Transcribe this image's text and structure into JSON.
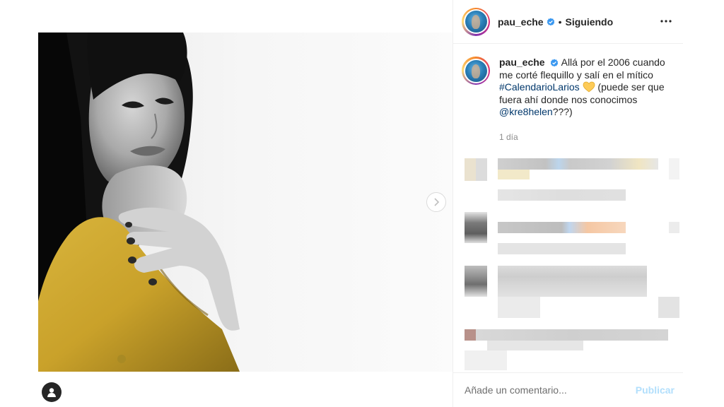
{
  "post": {
    "username": "pau_eche",
    "follow_state": "Siguiendo",
    "dot": "•"
  },
  "caption": {
    "username": "pau_eche",
    "text_1": "Allá por el 2006 cuando me corté flequillo y salí en el mítico",
    "hashtag": "#CalendarioLarios",
    "text_2": "(puede ser que fuera ahí donde nos conocimos",
    "mention": "@kre8helen",
    "text_3": "???)",
    "timestamp": "1 día"
  },
  "footer": {
    "placeholder": "Añade un comentario...",
    "publish_label": "Publicar"
  },
  "colors": {
    "verified": "#3897f0",
    "link": "#00376b",
    "publish_disabled": "#b2dffc",
    "heart": "#fdcb58"
  },
  "icons": {
    "verified": "verified-badge-icon",
    "more": "more-options-icon",
    "next": "chevron-right-icon",
    "heart": "yellow-heart-icon"
  }
}
